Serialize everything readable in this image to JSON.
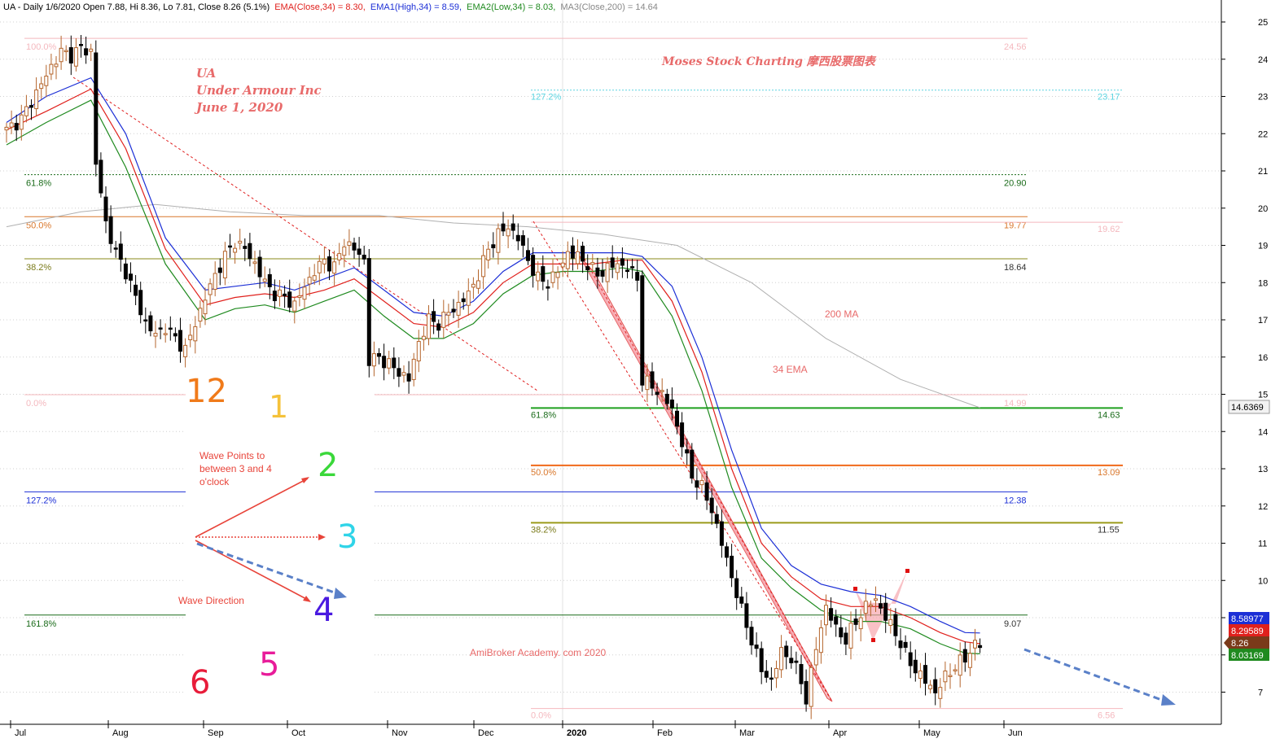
{
  "header": {
    "prefix": "UA - Daily 1/6/2020 Open 7.88, Hi 8.36, Lo 7.81, Close 8.26 (5.1%)",
    "ema_close": "EMA(Close,34) = 8.30,",
    "ema_high": "EMA1(High,34) = 8.59,",
    "ema_low": "EMA2(Low,34) = 8.03,",
    "ma200": "MA3(Close,200) = 14.64"
  },
  "colors": {
    "ema_close": "#e0201c",
    "ema_high": "#1c2fd6",
    "ema_low": "#1f8a1f",
    "ma200": "#b0b0b0",
    "candle_up": "#b5652c",
    "candle_down": "#000000",
    "pink": "#f6a0a8",
    "annotation": "#e86a6a"
  },
  "annotations": {
    "ticker": "UA",
    "company": "Under Armour Inc",
    "date": "June 1, 2020",
    "brand": "Moses Stock Charting 摩西股票图表",
    "ma_label": "200 MA",
    "ema_label": "34 EMA",
    "wave_points_1": "Wave Points to",
    "wave_points_2": "between 3 and 4",
    "wave_points_3": "o'clock",
    "wave_direction": "Wave Direction",
    "academy": "AmiBroker Academy. com 2020"
  },
  "clock": {
    "n12": "12",
    "n1": "1",
    "n2": "2",
    "n3": "3",
    "n4": "4",
    "n5": "5",
    "n6": "6"
  },
  "price_badges": {
    "ma200": "14.6369",
    "ema_high": "8.58977",
    "ema_close": "8.29589",
    "close": "8.26",
    "ema_low": "8.03169"
  },
  "chart_data": {
    "type": "candlestick",
    "title": "UA - Daily 1/6/2020",
    "ylim": [
      6.2,
      25.4
    ],
    "y_ticks": [
      7,
      8,
      9,
      10,
      11,
      12,
      13,
      14,
      15,
      16,
      17,
      18,
      19,
      20,
      21,
      22,
      23,
      24,
      25
    ],
    "x_ticks": [
      "Jul",
      "Aug",
      "Sep",
      "Oct",
      "Nov",
      "Dec",
      "2020",
      "Feb",
      "Mar",
      "Apr",
      "May",
      "Jun"
    ],
    "fib_set_1": {
      "levels": [
        {
          "label": "100.0%",
          "value": "24.56"
        },
        {
          "label": "61.8%",
          "value": "20.90"
        },
        {
          "label": "50.0%",
          "value": "19.77"
        },
        {
          "label": "38.2%",
          "value": "18.64"
        },
        {
          "label": "0.0%",
          "value": "14.99"
        },
        {
          "label": "127.2%",
          "value": "12.38"
        },
        {
          "label": "161.8%",
          "value": "9.07"
        }
      ]
    },
    "fib_set_2": {
      "levels": [
        {
          "label": "127.2%",
          "value": "23.17"
        },
        {
          "label": "",
          "value": "19.62"
        },
        {
          "label": "61.8%",
          "value": "14.63"
        },
        {
          "label": "50.0%",
          "value": "13.09"
        },
        {
          "label": "38.2%",
          "value": "11.55"
        },
        {
          "label": "0.0%",
          "value": "6.56"
        }
      ]
    },
    "close_path": [
      [
        0,
        22.1
      ],
      [
        3,
        22.4
      ],
      [
        6,
        23.1
      ],
      [
        9,
        23.8
      ],
      [
        11,
        24.2
      ],
      [
        13,
        24.1
      ],
      [
        15,
        24.3
      ],
      [
        17,
        24.2
      ],
      [
        18,
        21.2
      ],
      [
        20,
        19.6
      ],
      [
        22,
        18.8
      ],
      [
        24,
        18.3
      ],
      [
        26,
        17.6
      ],
      [
        28,
        16.9
      ],
      [
        30,
        16.6
      ],
      [
        32,
        16.8
      ],
      [
        34,
        16.5
      ],
      [
        36,
        16.2
      ],
      [
        38,
        16.9
      ],
      [
        40,
        17.6
      ],
      [
        42,
        18.2
      ],
      [
        44,
        18.7
      ],
      [
        46,
        19.1
      ],
      [
        48,
        18.9
      ],
      [
        50,
        18.5
      ],
      [
        52,
        18.0
      ],
      [
        54,
        17.7
      ],
      [
        56,
        17.6
      ],
      [
        58,
        17.4
      ],
      [
        60,
        17.9
      ],
      [
        62,
        18.3
      ],
      [
        64,
        18.6
      ],
      [
        66,
        18.4
      ],
      [
        68,
        19.1
      ],
      [
        70,
        18.9
      ],
      [
        72,
        18.6
      ],
      [
        73,
        15.9
      ],
      [
        75,
        16.0
      ],
      [
        77,
        15.8
      ],
      [
        79,
        15.6
      ],
      [
        81,
        15.4
      ],
      [
        83,
        16.4
      ],
      [
        85,
        17.0
      ],
      [
        87,
        16.9
      ],
      [
        89,
        17.2
      ],
      [
        91,
        17.4
      ],
      [
        93,
        17.7
      ],
      [
        95,
        18.2
      ],
      [
        97,
        18.9
      ],
      [
        99,
        19.3
      ],
      [
        101,
        19.5
      ],
      [
        103,
        19.2
      ],
      [
        105,
        18.6
      ],
      [
        107,
        18.1
      ],
      [
        109,
        18.0
      ],
      [
        111,
        18.3
      ],
      [
        113,
        18.8
      ],
      [
        115,
        18.7
      ],
      [
        117,
        18.5
      ],
      [
        119,
        18.2
      ],
      [
        121,
        18.4
      ],
      [
        123,
        18.5
      ],
      [
        125,
        18.4
      ],
      [
        127,
        18.1
      ],
      [
        128,
        15.4
      ],
      [
        130,
        15.2
      ],
      [
        132,
        15.0
      ],
      [
        134,
        14.6
      ],
      [
        136,
        13.7
      ],
      [
        138,
        12.8
      ],
      [
        140,
        12.5
      ],
      [
        142,
        11.9
      ],
      [
        144,
        11.0
      ],
      [
        146,
        10.1
      ],
      [
        148,
        9.2
      ],
      [
        150,
        8.4
      ],
      [
        152,
        7.6
      ],
      [
        154,
        7.3
      ],
      [
        156,
        8.1
      ],
      [
        158,
        7.9
      ],
      [
        160,
        7.3
      ],
      [
        161,
        6.8
      ],
      [
        163,
        8.2
      ],
      [
        165,
        9.3
      ],
      [
        167,
        8.7
      ],
      [
        169,
        8.4
      ],
      [
        171,
        8.9
      ],
      [
        173,
        9.3
      ],
      [
        175,
        9.5
      ],
      [
        177,
        9.0
      ],
      [
        179,
        8.6
      ],
      [
        181,
        8.0
      ],
      [
        183,
        7.6
      ],
      [
        185,
        7.3
      ],
      [
        187,
        7.0
      ],
      [
        189,
        7.4
      ],
      [
        191,
        7.7
      ],
      [
        193,
        7.9
      ],
      [
        195,
        8.3
      ],
      [
        196,
        8.26
      ]
    ],
    "ema_close_path": [
      [
        0,
        22.1
      ],
      [
        8,
        22.6
      ],
      [
        17,
        23.2
      ],
      [
        24,
        21.6
      ],
      [
        32,
        18.9
      ],
      [
        40,
        17.4
      ],
      [
        46,
        17.6
      ],
      [
        52,
        17.7
      ],
      [
        58,
        17.6
      ],
      [
        64,
        17.8
      ],
      [
        70,
        18.1
      ],
      [
        76,
        17.5
      ],
      [
        82,
        16.9
      ],
      [
        88,
        16.8
      ],
      [
        94,
        17.2
      ],
      [
        100,
        18.0
      ],
      [
        106,
        18.5
      ],
      [
        112,
        18.5
      ],
      [
        118,
        18.5
      ],
      [
        124,
        18.6
      ],
      [
        128,
        18.6
      ],
      [
        134,
        17.5
      ],
      [
        140,
        15.6
      ],
      [
        146,
        13.0
      ],
      [
        152,
        11.0
      ],
      [
        158,
        10.1
      ],
      [
        164,
        9.5
      ],
      [
        170,
        9.3
      ],
      [
        176,
        9.3
      ],
      [
        182,
        9.0
      ],
      [
        188,
        8.6
      ],
      [
        193,
        8.35
      ],
      [
        196,
        8.3
      ]
    ],
    "ema_high_path": [
      [
        0,
        22.3
      ],
      [
        8,
        23.0
      ],
      [
        17,
        23.5
      ],
      [
        24,
        22.0
      ],
      [
        32,
        19.2
      ],
      [
        40,
        17.8
      ],
      [
        46,
        17.9
      ],
      [
        52,
        18.0
      ],
      [
        58,
        17.8
      ],
      [
        64,
        18.1
      ],
      [
        70,
        18.4
      ],
      [
        76,
        17.8
      ],
      [
        82,
        17.2
      ],
      [
        88,
        17.1
      ],
      [
        94,
        17.5
      ],
      [
        100,
        18.3
      ],
      [
        106,
        18.8
      ],
      [
        112,
        18.8
      ],
      [
        118,
        18.8
      ],
      [
        124,
        18.8
      ],
      [
        128,
        18.7
      ],
      [
        134,
        17.9
      ],
      [
        140,
        16.0
      ],
      [
        146,
        13.5
      ],
      [
        152,
        11.4
      ],
      [
        158,
        10.4
      ],
      [
        164,
        9.9
      ],
      [
        170,
        9.7
      ],
      [
        176,
        9.6
      ],
      [
        182,
        9.3
      ],
      [
        188,
        8.9
      ],
      [
        193,
        8.6
      ],
      [
        196,
        8.59
      ]
    ],
    "ema_low_path": [
      [
        0,
        21.7
      ],
      [
        8,
        22.3
      ],
      [
        17,
        22.9
      ],
      [
        24,
        21.1
      ],
      [
        32,
        18.5
      ],
      [
        40,
        17.0
      ],
      [
        46,
        17.3
      ],
      [
        52,
        17.4
      ],
      [
        58,
        17.2
      ],
      [
        64,
        17.5
      ],
      [
        70,
        17.8
      ],
      [
        76,
        17.1
      ],
      [
        82,
        16.5
      ],
      [
        88,
        16.5
      ],
      [
        94,
        16.9
      ],
      [
        100,
        17.7
      ],
      [
        106,
        18.2
      ],
      [
        112,
        18.3
      ],
      [
        118,
        18.3
      ],
      [
        124,
        18.4
      ],
      [
        128,
        18.3
      ],
      [
        134,
        17.1
      ],
      [
        140,
        15.1
      ],
      [
        146,
        12.5
      ],
      [
        152,
        10.6
      ],
      [
        158,
        9.8
      ],
      [
        164,
        9.2
      ],
      [
        170,
        8.9
      ],
      [
        176,
        8.9
      ],
      [
        182,
        8.7
      ],
      [
        188,
        8.3
      ],
      [
        193,
        8.05
      ],
      [
        196,
        8.03
      ]
    ],
    "ma200_path": [
      [
        0,
        19.5
      ],
      [
        15,
        19.9
      ],
      [
        30,
        20.1
      ],
      [
        45,
        19.9
      ],
      [
        60,
        19.8
      ],
      [
        75,
        19.8
      ],
      [
        90,
        19.6
      ],
      [
        105,
        19.5
      ],
      [
        120,
        19.3
      ],
      [
        135,
        19.0
      ],
      [
        150,
        18.0
      ],
      [
        165,
        16.5
      ],
      [
        180,
        15.4
      ],
      [
        196,
        14.64
      ]
    ]
  }
}
